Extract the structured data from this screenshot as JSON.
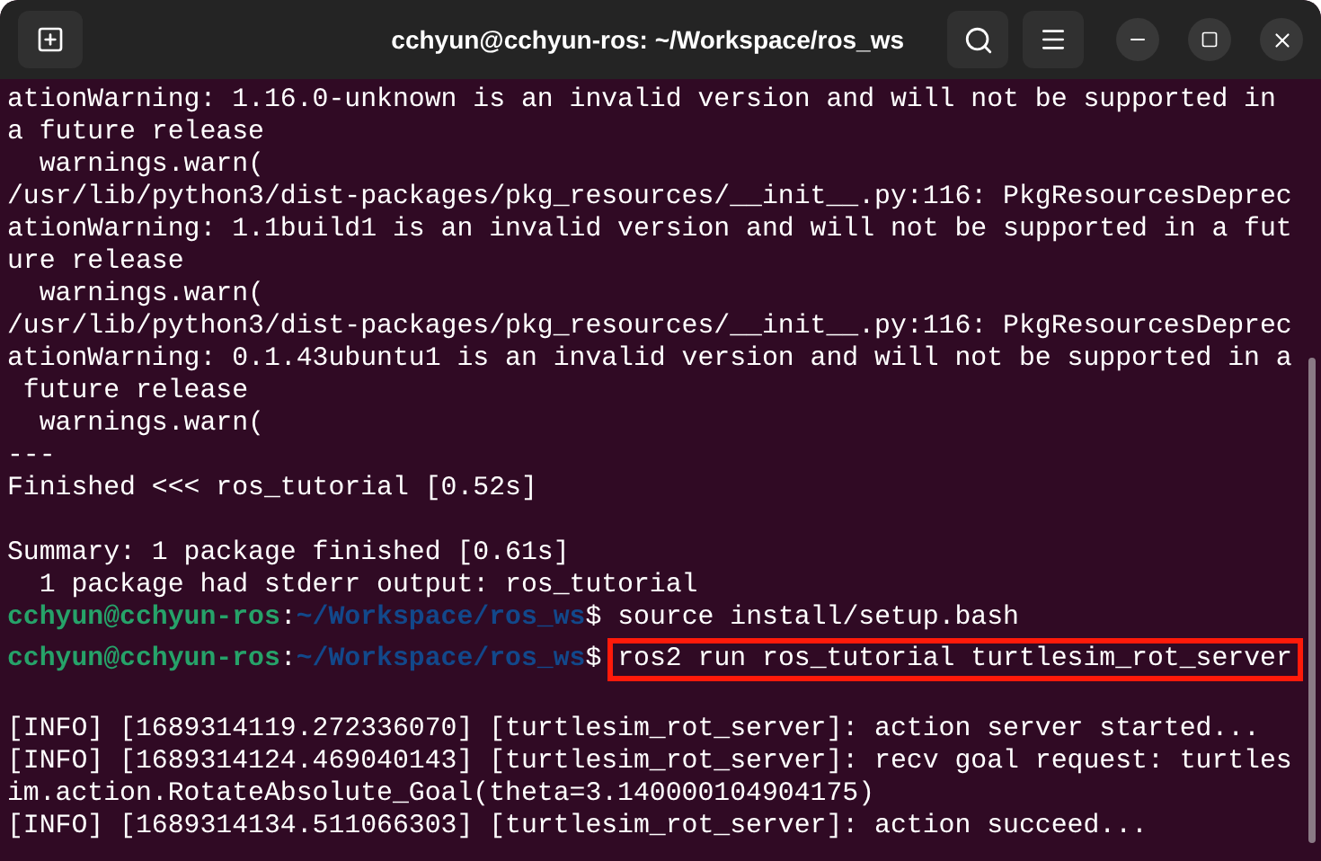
{
  "window": {
    "title": "cchyun@cchyun-ros: ~/Workspace/ros_ws"
  },
  "lines": [
    {
      "kind": "output",
      "text": "ationWarning: 1.16.0-unknown is an invalid version and will not be supported in"
    },
    {
      "kind": "output",
      "text": "a future release"
    },
    {
      "kind": "output",
      "text": "  warnings.warn("
    },
    {
      "kind": "output",
      "text": "/usr/lib/python3/dist-packages/pkg_resources/__init__.py:116: PkgResourcesDeprec"
    },
    {
      "kind": "output",
      "text": "ationWarning: 1.1build1 is an invalid version and will not be supported in a fut"
    },
    {
      "kind": "output",
      "text": "ure release"
    },
    {
      "kind": "output",
      "text": "  warnings.warn("
    },
    {
      "kind": "output",
      "text": "/usr/lib/python3/dist-packages/pkg_resources/__init__.py:116: PkgResourcesDeprec"
    },
    {
      "kind": "output",
      "text": "ationWarning: 0.1.43ubuntu1 is an invalid version and will not be supported in a"
    },
    {
      "kind": "output",
      "text": " future release"
    },
    {
      "kind": "output",
      "text": "  warnings.warn("
    },
    {
      "kind": "output",
      "text": "---"
    },
    {
      "kind": "output",
      "text": "Finished <<< ros_tutorial [0.52s]"
    },
    {
      "kind": "blank"
    },
    {
      "kind": "output",
      "text": "Summary: 1 package finished [0.61s]"
    },
    {
      "kind": "output",
      "text": "  1 package had stderr output: ros_tutorial"
    },
    {
      "kind": "prompt",
      "user": "cchyun@cchyun-ros",
      "colon": ":",
      "path": "~/Workspace/ros_ws",
      "dollar": "$",
      "command": "source install/setup.bash",
      "highlighted": false
    },
    {
      "kind": "prompt",
      "user": "cchyun@cchyun-ros",
      "colon": ":",
      "path": "~/Workspace/ros_ws",
      "dollar": "$",
      "command": "ros2 run ros_tutorial turtlesim_rot_server",
      "highlighted": true
    },
    {
      "kind": "blank"
    },
    {
      "kind": "output",
      "text": "[INFO] [1689314119.272336070] [turtlesim_rot_server]: action server started..."
    },
    {
      "kind": "output",
      "text": "[INFO] [1689314124.469040143] [turtlesim_rot_server]: recv goal request: turtles"
    },
    {
      "kind": "output",
      "text": "im.action.RotateAbsolute_Goal(theta=3.140000104904175)"
    },
    {
      "kind": "output",
      "text": "[INFO] [1689314134.511066303] [turtlesim_rot_server]: action succeed..."
    }
  ]
}
